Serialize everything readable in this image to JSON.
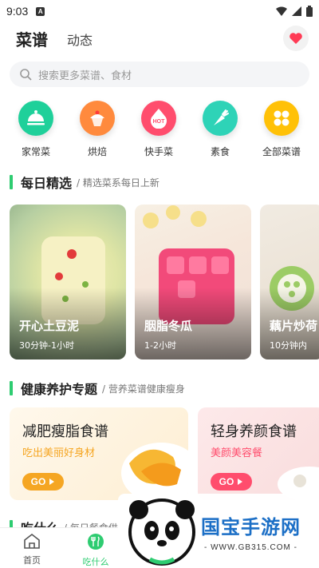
{
  "status_bar": {
    "time": "9:03",
    "notification_letter": "A"
  },
  "header": {
    "tab_active": "菜谱",
    "tab_other": "动态"
  },
  "search": {
    "placeholder": "搜索更多菜谱、食材"
  },
  "categories": [
    {
      "label": "家常菜",
      "icon": "dish-cover-icon",
      "color": "#1fd09a"
    },
    {
      "label": "烘焙",
      "icon": "cupcake-icon",
      "color": "#ff8a3d"
    },
    {
      "label": "快手菜",
      "icon": "hot-badge-icon",
      "color": "#ff4d6d"
    },
    {
      "label": "素食",
      "icon": "carrot-icon",
      "color": "#2ed3b7"
    },
    {
      "label": "全部菜谱",
      "icon": "grid-icon",
      "color": "#ffc107"
    }
  ],
  "daily": {
    "title": "每日精选",
    "subtitle": "/ 精选菜系每日上新",
    "items": [
      {
        "name": "开心土豆泥",
        "time": "30分钟-1小时"
      },
      {
        "name": "胭脂冬瓜",
        "time": "1-2小时"
      },
      {
        "name": "藕片炒荷",
        "time": "10分钟内"
      }
    ]
  },
  "health": {
    "title": "健康养护专题",
    "subtitle": "/ 营养菜谱健康瘦身",
    "items": [
      {
        "title": "减肥瘦脂食谱",
        "subtitle": "吃出美丽好身材",
        "go": "GO",
        "accent": "#f5a623"
      },
      {
        "title": "轻身养颜食谱",
        "subtitle": "美颜美容餐",
        "go": "GO",
        "accent": "#ff4d6d"
      }
    ]
  },
  "what_to_eat": {
    "title": "吃什么",
    "subtitle": "/ 每日餐食供"
  },
  "bottom_nav": [
    {
      "label": "首页",
      "active": false
    },
    {
      "label": "吃什么",
      "active": true
    }
  ],
  "watermark": {
    "text": "国宝手游网",
    "url": "- WWW.GB315.COM -"
  },
  "colors": {
    "accent_green": "#2ecc71",
    "heart_red": "#ff3b55"
  }
}
